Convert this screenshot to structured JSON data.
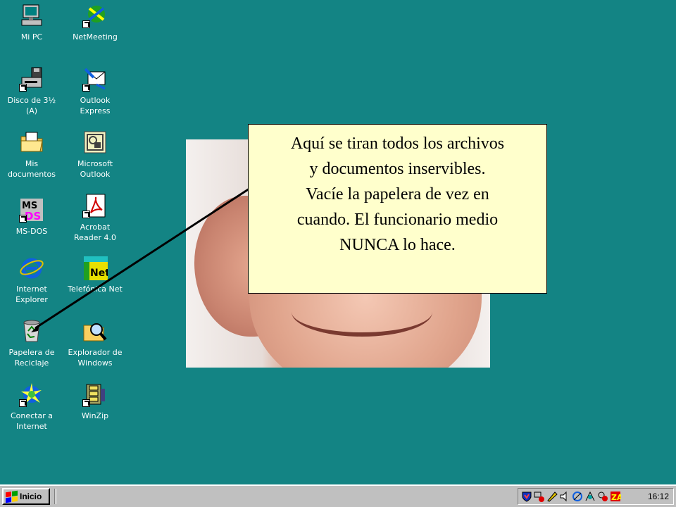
{
  "desktop": {
    "icons": [
      {
        "label": "Mi PC",
        "icon": "my-computer-icon"
      },
      {
        "label": "NetMeeting",
        "icon": "netmeeting-icon"
      },
      {
        "label": "Disco de 3½\n(A)",
        "icon": "floppy-drive-icon"
      },
      {
        "label": "Outlook\nExpress",
        "icon": "outlook-express-icon"
      },
      {
        "label": "Mis\ndocumentos",
        "icon": "my-documents-folder-icon"
      },
      {
        "label": "Microsoft\nOutlook",
        "icon": "microsoft-outlook-icon"
      },
      {
        "label": "MS-DOS",
        "icon": "ms-dos-icon"
      },
      {
        "label": "Acrobat\nReader 4.0",
        "icon": "acrobat-reader-icon"
      },
      {
        "label": "Internet\nExplorer",
        "icon": "internet-explorer-icon"
      },
      {
        "label": "Telefónica Net",
        "icon": "telefonica-net-icon"
      },
      {
        "label": "Papelera de\nReciclaje",
        "icon": "recycle-bin-icon"
      },
      {
        "label": "Explorador de\nWindows",
        "icon": "windows-explorer-icon"
      },
      {
        "label": "Conectar a\nInternet",
        "icon": "connect-internet-icon"
      },
      {
        "label": "WinZip",
        "icon": "winzip-icon"
      }
    ]
  },
  "callout": {
    "lines": [
      "Aquí se tiran todos los archivos",
      "y documentos inservibles.",
      "Vacíe la papelera de vez en",
      "cuando. El funcionario medio",
      "NUNCA lo hace."
    ]
  },
  "taskbar": {
    "start_label": "Inicio",
    "clock": "16:12",
    "tray_icons": [
      "shield-icon",
      "network-icon",
      "pen-icon",
      "speaker-icon",
      "antivirus-icon",
      "connection-icon",
      "virus-scan-icon",
      "zonealarm-icon"
    ]
  },
  "colors": {
    "desktop": "#138484",
    "taskbar": "#c0c0c0",
    "callout_bg": "#ffffcc"
  }
}
